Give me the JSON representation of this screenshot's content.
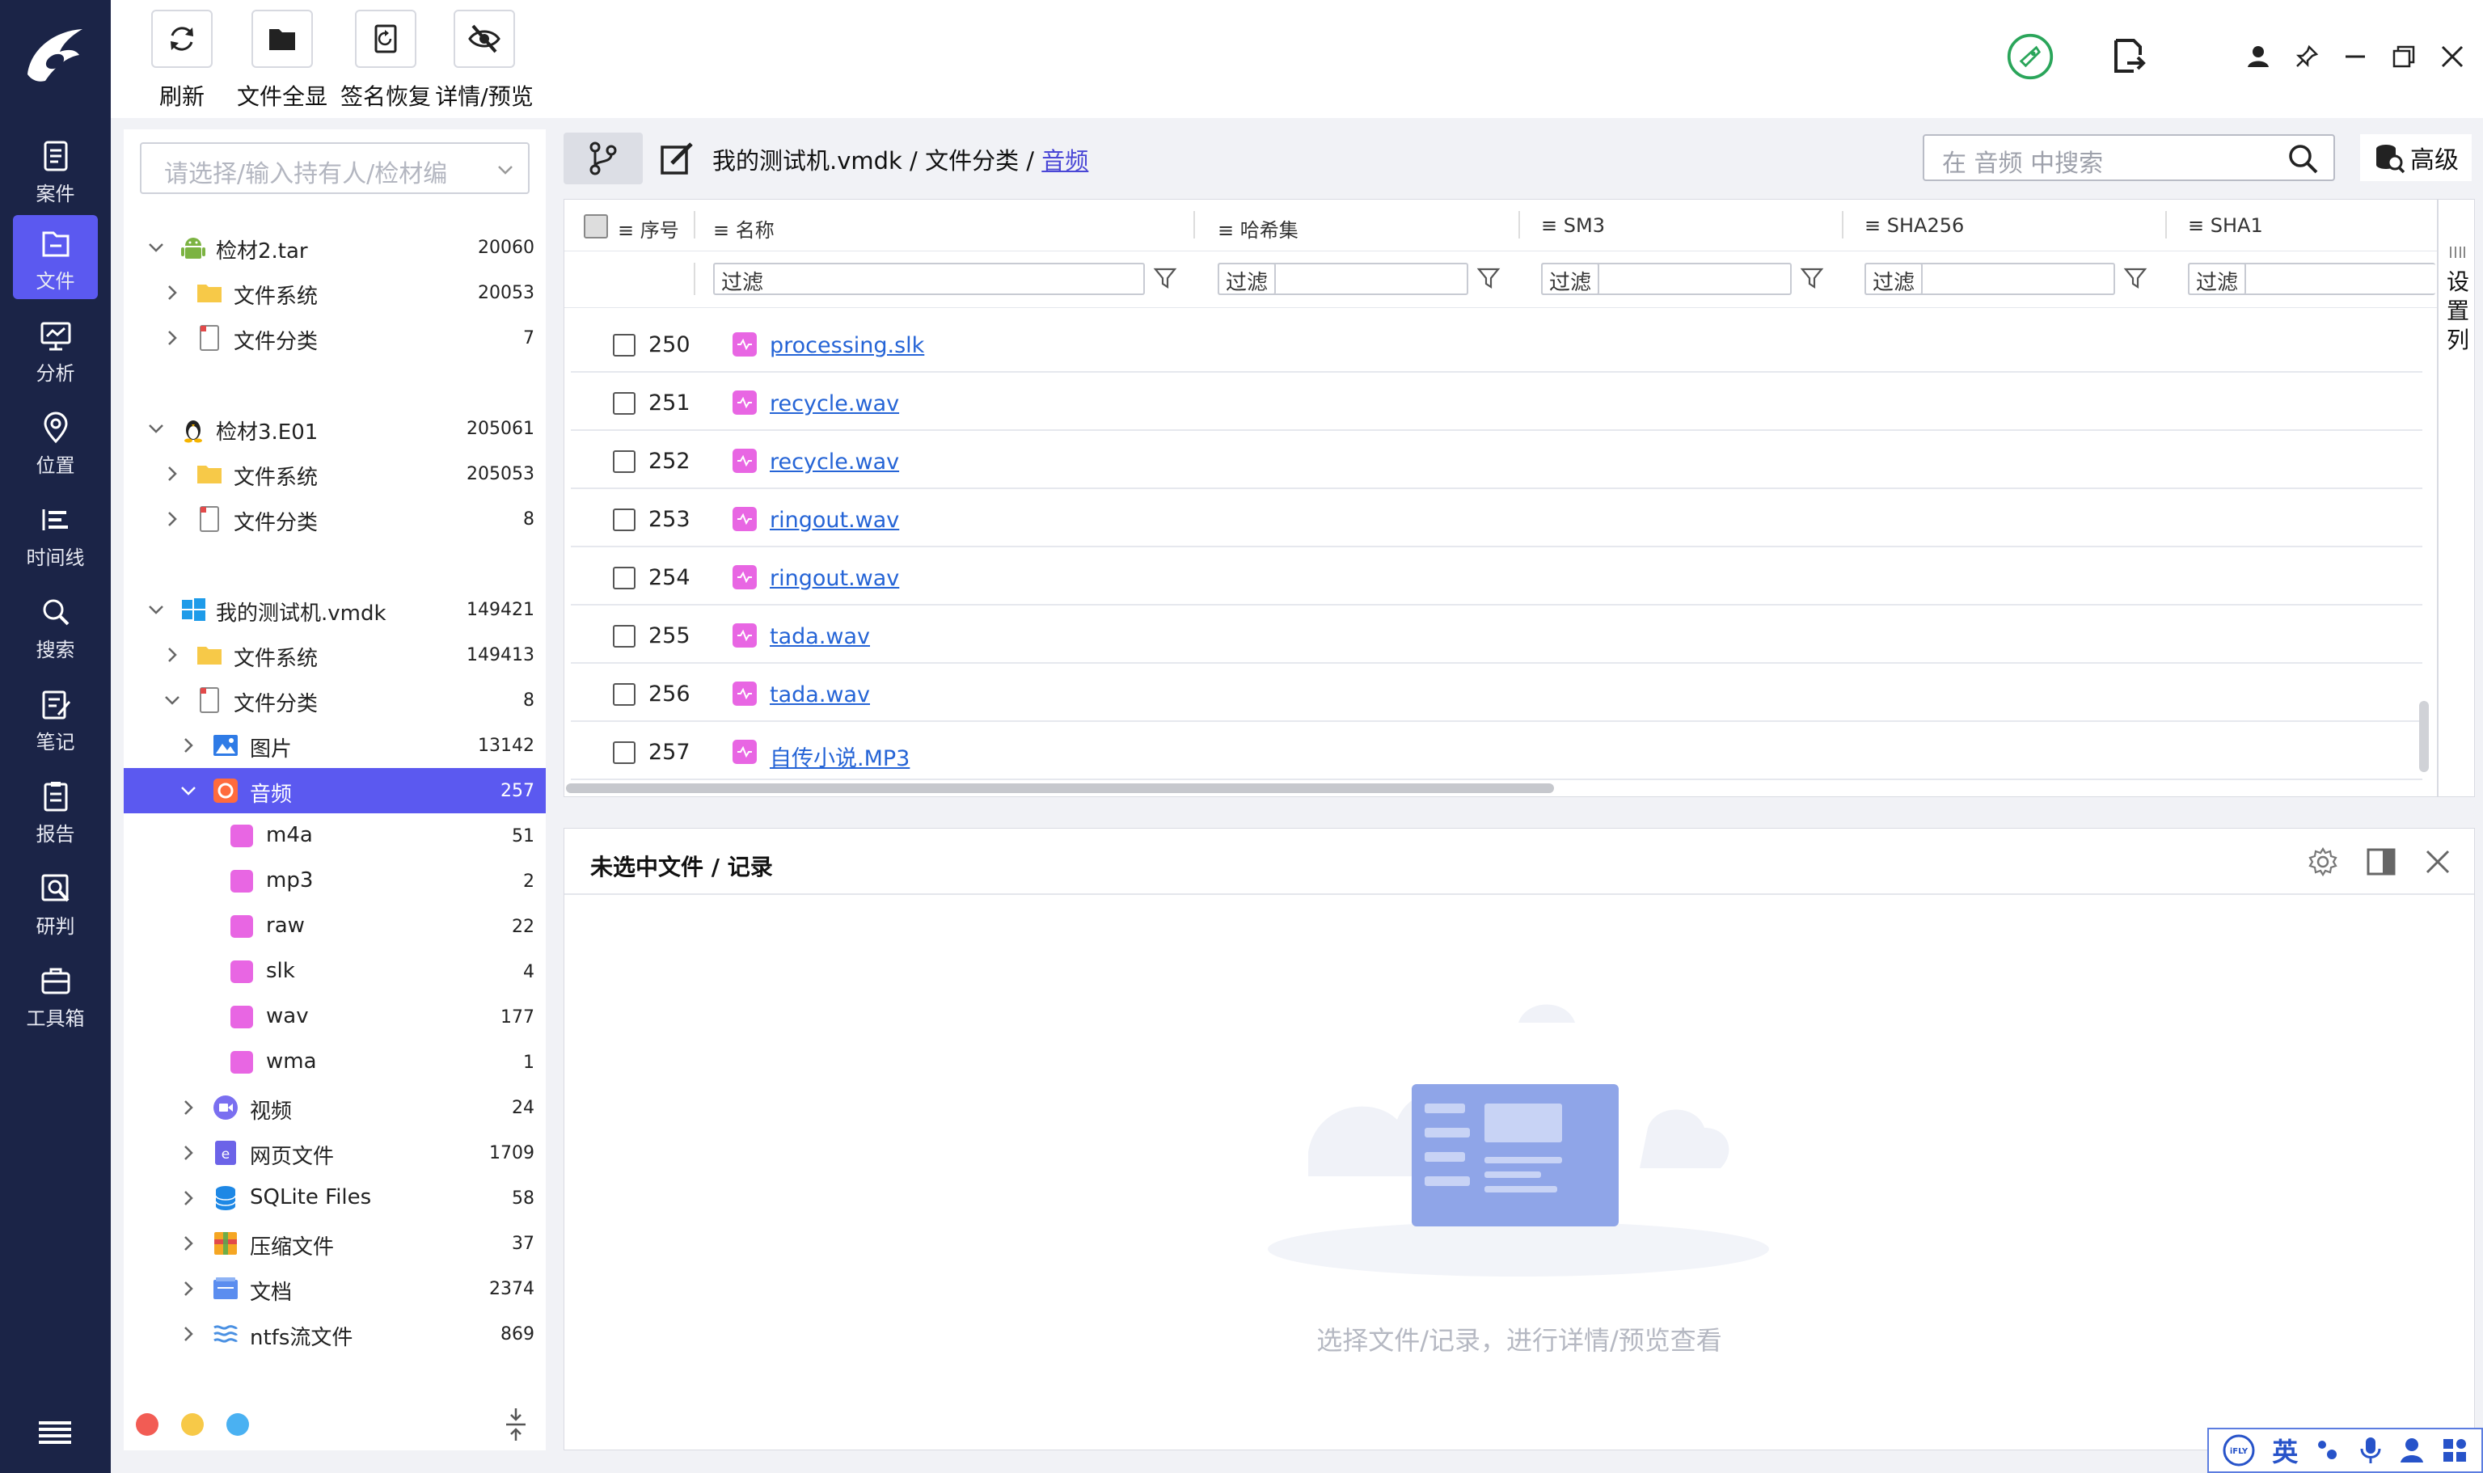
{
  "nav": {
    "items": [
      {
        "label": "案件",
        "icon": "case-icon"
      },
      {
        "label": "文件",
        "icon": "file-icon",
        "active": true
      },
      {
        "label": "分析",
        "icon": "analysis-icon"
      },
      {
        "label": "位置",
        "icon": "location-icon"
      },
      {
        "label": "时间线",
        "icon": "timeline-icon"
      },
      {
        "label": "搜索",
        "icon": "search-icon"
      },
      {
        "label": "笔记",
        "icon": "notes-icon"
      },
      {
        "label": "报告",
        "icon": "report-icon"
      },
      {
        "label": "研判",
        "icon": "judge-icon"
      },
      {
        "label": "工具箱",
        "icon": "toolbox-icon"
      }
    ]
  },
  "toolbar": {
    "refresh_label": "刷新",
    "show_all_label": "文件全显",
    "sign_restore_label": "签名恢复",
    "detail_preview_label": "详情/预览"
  },
  "tree": {
    "holder_placeholder": "请选择/输入持有人/检材编",
    "nodes": [
      {
        "name": "检材2.tar",
        "count": "20060"
      },
      {
        "name": "文件系统",
        "count": "20053"
      },
      {
        "name": "文件分类",
        "count": "7"
      },
      {
        "name": "检材3.E01",
        "count": "205061"
      },
      {
        "name": "文件系统",
        "count": "205053"
      },
      {
        "name": "文件分类",
        "count": "8"
      },
      {
        "name": "我的测试机.vmdk",
        "count": "149421"
      },
      {
        "name": "文件系统",
        "count": "149413"
      },
      {
        "name": "文件分类",
        "count": "8"
      },
      {
        "name": "图片",
        "count": "13142"
      },
      {
        "name": "音频",
        "count": "257"
      },
      {
        "name": "m4a",
        "count": "51"
      },
      {
        "name": "mp3",
        "count": "2"
      },
      {
        "name": "raw",
        "count": "22"
      },
      {
        "name": "slk",
        "count": "4"
      },
      {
        "name": "wav",
        "count": "177"
      },
      {
        "name": "wma",
        "count": "1"
      },
      {
        "name": "视频",
        "count": "24"
      },
      {
        "name": "网页文件",
        "count": "1709"
      },
      {
        "name": "SQLite Files",
        "count": "58"
      },
      {
        "name": "压缩文件",
        "count": "37"
      },
      {
        "name": "文档",
        "count": "2374"
      },
      {
        "name": "ntfs流文件",
        "count": "869"
      }
    ]
  },
  "breadcrumb": {
    "part1": "我的测试机.vmdk",
    "sep": " / ",
    "part2": "文件分类",
    "current": "音频"
  },
  "search": {
    "placeholder": "在 音频 中搜索"
  },
  "advanced_label": "高级",
  "grid": {
    "headers": {
      "index": "序号",
      "name": "名称",
      "hashset": "哈希集",
      "sm3": "SM3",
      "sha256": "SHA256",
      "sha1": "SHA1"
    },
    "filter_label": "过滤",
    "set_columns_label": "设置列",
    "rows": [
      {
        "index": "250",
        "name": "processing.slk"
      },
      {
        "index": "251",
        "name": "recycle.wav"
      },
      {
        "index": "252",
        "name": "recycle.wav"
      },
      {
        "index": "253",
        "name": "ringout.wav"
      },
      {
        "index": "254",
        "name": "ringout.wav"
      },
      {
        "index": "255",
        "name": "tada.wav"
      },
      {
        "index": "256",
        "name": "tada.wav"
      },
      {
        "index": "257",
        "name": "自传小说.MP3"
      }
    ]
  },
  "detail": {
    "title": "未选中文件 / 记录",
    "empty_message": "选择文件/记录，进行详情/预览查看"
  },
  "ime": {
    "lang": "英"
  },
  "colors": {
    "nav_bg": "#1b2447",
    "accent": "#5b59f0",
    "link": "#2564d6",
    "audio_icon": "#e866e3"
  }
}
